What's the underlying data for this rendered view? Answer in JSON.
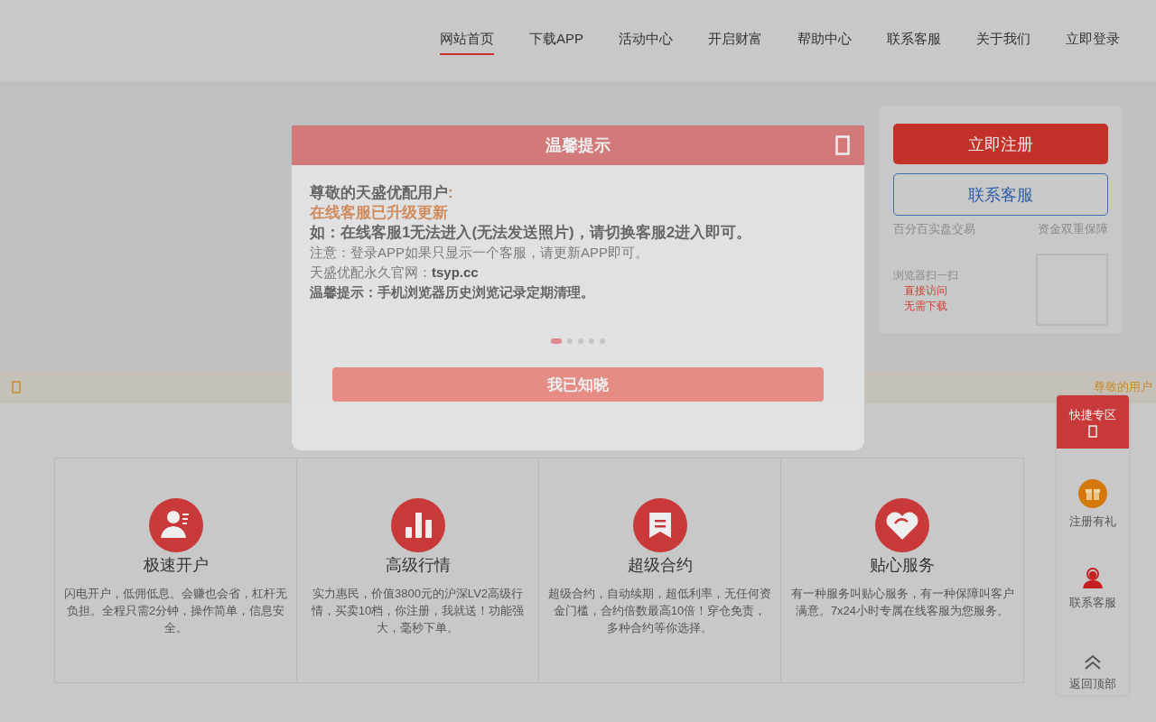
{
  "nav": [
    {
      "label": "网站首页",
      "selected": true
    },
    {
      "label": "下载APP",
      "selected": false
    },
    {
      "label": "活动中心",
      "selected": false
    },
    {
      "label": "开启财富",
      "selected": false
    },
    {
      "label": "帮助中心",
      "selected": false
    },
    {
      "label": "联系客服",
      "selected": false
    },
    {
      "label": "关于我们",
      "selected": false
    },
    {
      "label": "立即登录",
      "selected": false
    }
  ],
  "side_card": {
    "register_button": "立即注册",
    "service_button": "联系客服",
    "features": [
      "百分百实盘交易",
      "资金双重保障"
    ],
    "scan_label": "浏览器扫一扫",
    "scan_notes": [
      "直接访问",
      "无需下载"
    ]
  },
  "marquee": {
    "text": "尊敬的用户"
  },
  "features": [
    {
      "kind": "person",
      "title": "极速开户",
      "description": "闪电开户，低佣低息。会赚也会省，杠杆无负担。全程只需2分钟，操作简单，信息安全。"
    },
    {
      "kind": "chart",
      "title": "高级行情",
      "description": "实力惠民，价值3800元的沪深LV2高级行情，买卖10档，你注册，我就送！功能强大，毫秒下单。"
    },
    {
      "kind": "bookmark",
      "title": "超级合约",
      "description": "超级合约，自动续期，超低利率，无任何资金门槛，合约倍数最高10倍！穿仓免责，多种合约等你选择。"
    },
    {
      "kind": "heart",
      "title": "贴心服务",
      "description": "有一种服务叫贴心服务，有一种保障叫客户满意。7x24小时专属在线客服为您服务。"
    }
  ],
  "quick_panel": {
    "title": "快捷专区",
    "items": [
      {
        "kind": "gift",
        "label": "注册有礼"
      },
      {
        "kind": "agent",
        "label": "联系客服"
      },
      {
        "kind": "top",
        "label": "返回顶部"
      }
    ]
  },
  "modal": {
    "title": "温馨提示",
    "lines": [
      {
        "kind": "greeting",
        "text": "尊敬的天盛优配用户",
        "suffix": ":"
      },
      {
        "kind": "highlight",
        "text": "在线客服已升级更新"
      },
      {
        "kind": "strong",
        "text": "如：在线客服1无法进入(无法发送照片)，请切换客服2进入即可。"
      },
      {
        "kind": "note",
        "text": "注意：登录APP如果只显示一个客服，请更新APP即可。"
      },
      {
        "kind": "note",
        "text": "天盛优配永久官网：**tsyp.cc**"
      },
      {
        "kind": "bold",
        "text": "温馨提示：手机浏览器历史浏览记录定期清理。"
      }
    ],
    "dots": [
      {
        "selected": true
      },
      {
        "selected": false
      },
      {
        "selected": false
      },
      {
        "selected": false
      },
      {
        "selected": false
      }
    ],
    "confirm_button": "我已知晓"
  }
}
